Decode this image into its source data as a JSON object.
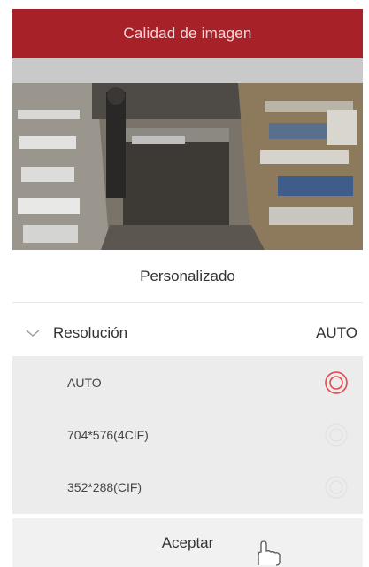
{
  "header": {
    "title": "Calidad de imagen"
  },
  "preview": {
    "overlay_text": ""
  },
  "mode": {
    "label": "Personalizado"
  },
  "resolution": {
    "label": "Resolución",
    "current_value": "AUTO",
    "expanded": true,
    "options": [
      {
        "label": "AUTO",
        "selected": true
      },
      {
        "label": "704*576(4CIF)",
        "selected": false
      },
      {
        "label": "352*288(CIF)",
        "selected": false
      }
    ]
  },
  "footer": {
    "accept_label": "Aceptar"
  },
  "colors": {
    "accent": "#a62228",
    "radio_selected": "#e5484d",
    "options_bg": "#ececec"
  }
}
